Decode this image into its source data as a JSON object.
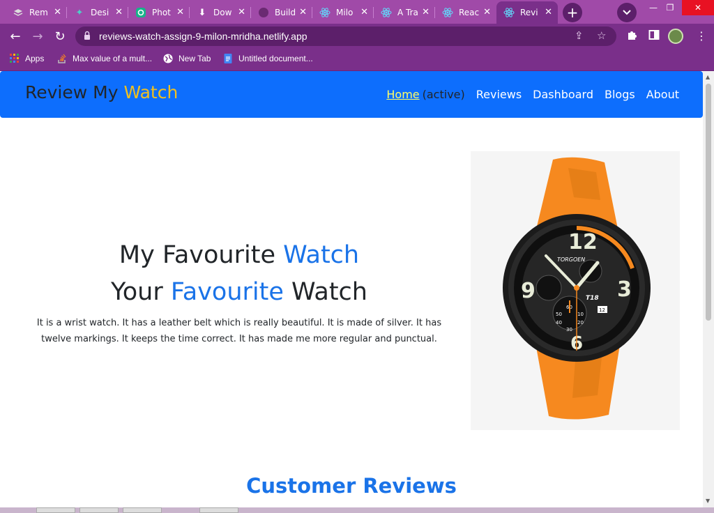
{
  "browser": {
    "tabs": [
      {
        "title": "Rem",
        "icon": "layers-icon",
        "active": false
      },
      {
        "title": "Desi",
        "icon": "sparkle-icon",
        "active": false
      },
      {
        "title": "Phot",
        "icon": "photo-app-icon",
        "active": false
      },
      {
        "title": "Dow",
        "icon": "download-icon",
        "active": false
      },
      {
        "title": "Build",
        "icon": "github-icon",
        "active": false
      },
      {
        "title": "Milo",
        "icon": "react-icon",
        "active": false
      },
      {
        "title": "A Tra",
        "icon": "react-icon",
        "active": false
      },
      {
        "title": "Reac",
        "icon": "react-icon",
        "active": false
      },
      {
        "title": "Revi",
        "icon": "react-icon",
        "active": true
      }
    ],
    "url": "reviews-watch-assign-9-milon-mridha.netlify.app",
    "bookmarks": [
      {
        "label": "Apps",
        "icon": "apps-grid-icon"
      },
      {
        "label": "Max value of a mult...",
        "icon": "stackoverflow-icon"
      },
      {
        "label": "New Tab",
        "icon": "globe-icon"
      },
      {
        "label": "Untitled document...",
        "icon": "docs-icon"
      }
    ],
    "colors": {
      "frame": "#a04aa8",
      "toolbar": "#7a2f8a",
      "omnibox": "#5c1f6a"
    }
  },
  "site": {
    "brand_main": "Review My ",
    "brand_accent": "Watch",
    "nav": {
      "home": "Home",
      "home_note": "(active)",
      "reviews": "Reviews",
      "dashboard": "Dashboard",
      "blogs": "Blogs",
      "about": "About"
    },
    "hero": {
      "line1_a": "My Favourite ",
      "line1_b": "Watch",
      "line2_a": "Your ",
      "line2_b": "Favourite",
      "line2_c": " Watch",
      "description": "It is a wrist watch. It has a leather belt which is really beautiful. It is made of silver. It has twelve markings. It keeps the time correct. It has made me more regular and punctual."
    },
    "watch": {
      "brand": "TORGOEN",
      "model": "T18",
      "date": "12",
      "dial_numbers": [
        "12",
        "3",
        "6",
        "9"
      ],
      "subdial_numbers": [
        "60",
        "10",
        "20",
        "30",
        "40",
        "50"
      ]
    },
    "reviews_heading": "Customer Reviews",
    "colors": {
      "primary": "#0d6efd",
      "accent": "#f0c020",
      "blue_text": "#1a73e8",
      "strap": "#f6891f"
    }
  }
}
